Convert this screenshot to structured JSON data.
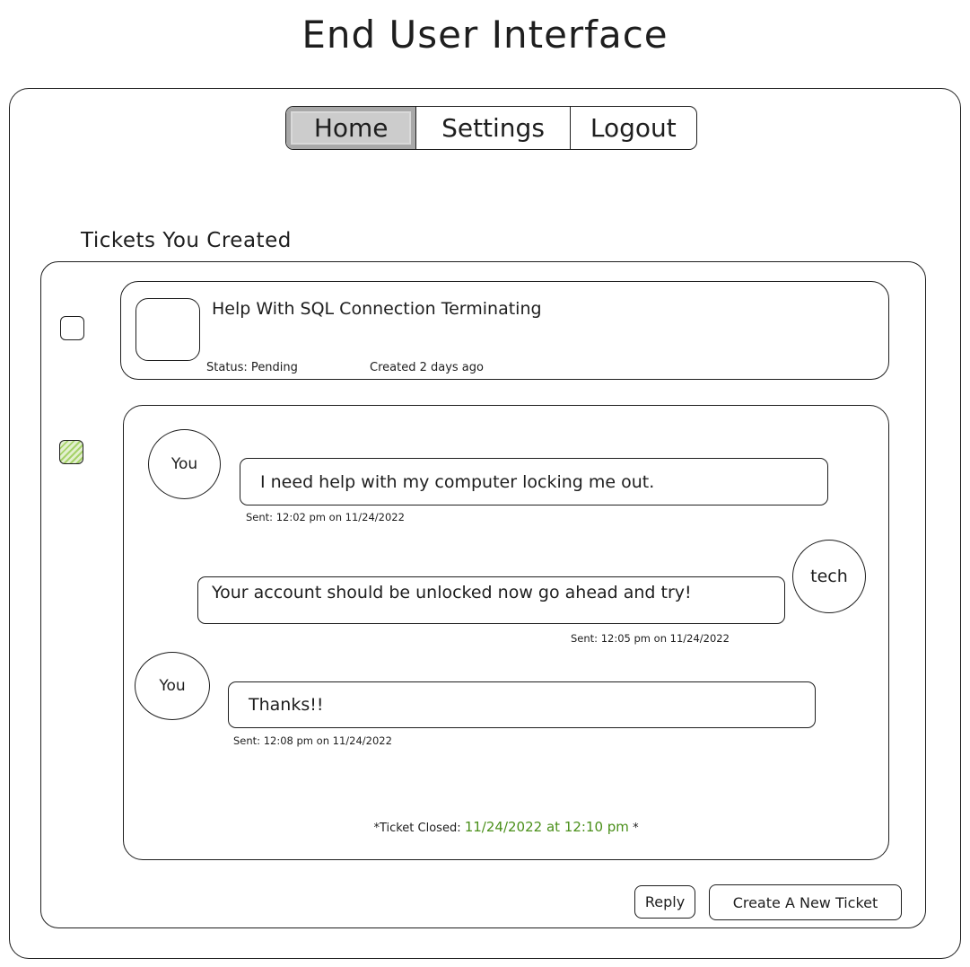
{
  "page_title": "End User Interface",
  "nav": {
    "tabs": [
      {
        "label": "Home",
        "active": true
      },
      {
        "label": "Settings",
        "active": false
      },
      {
        "label": "Logout",
        "active": false
      }
    ]
  },
  "tickets_section": {
    "heading": "Tickets You Created",
    "tickets": [
      {
        "title": "Help With SQL Connection Terminating",
        "status": "Status: Pending",
        "created": "Created 2 days ago",
        "checked": false
      }
    ],
    "thread": {
      "checked": true,
      "messages": [
        {
          "sender": "You",
          "text": "I need help with my computer locking me out.",
          "sent": "Sent: 12:02 pm   on   11/24/2022"
        },
        {
          "sender": "tech",
          "text": "Your account should be unlocked now go ahead and try!",
          "sent": "Sent: 12:05 pm   on   11/24/2022"
        },
        {
          "sender": "You",
          "text": "Thanks!!",
          "sent": "Sent: 12:08 pm   on   11/24/2022"
        }
      ],
      "closed_prefix": "*Ticket Closed:",
      "closed_value": "11/24/2022  at  12:10 pm",
      "closed_suffix": "*"
    }
  },
  "buttons": {
    "reply": "Reply",
    "create_ticket": "Create A New Ticket"
  },
  "colors": {
    "ink": "#1e1e1e",
    "active_tab": "#cccccc",
    "closed_green": "#4a8f1a",
    "checked_fill": "#a6d269"
  }
}
